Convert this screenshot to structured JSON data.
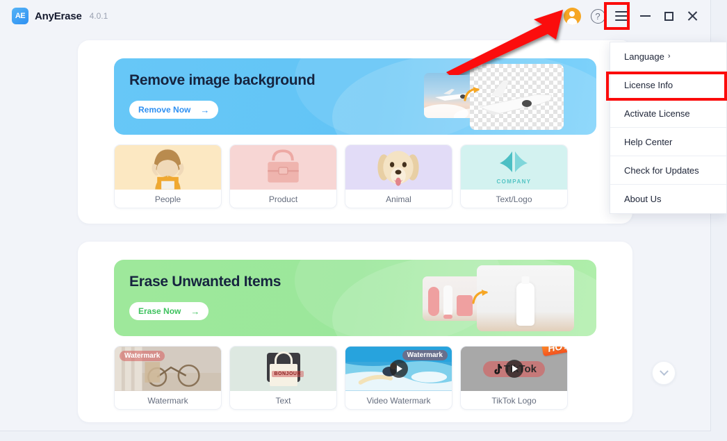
{
  "app": {
    "name": "AnyErase",
    "version": "4.0.1",
    "logo_text": "AE"
  },
  "titlebar": {
    "icons": [
      {
        "name": "account-avatar",
        "label": "Account"
      },
      {
        "name": "help-icon",
        "label": "?"
      },
      {
        "name": "menu-hamburger-icon",
        "label": "Menu"
      },
      {
        "name": "minimize-icon",
        "label": "Minimize"
      },
      {
        "name": "maximize-icon",
        "label": "Maximize"
      },
      {
        "name": "close-icon",
        "label": "Close"
      }
    ]
  },
  "dropdown_menu": {
    "items": [
      {
        "label": "Language",
        "has_submenu": true,
        "caret": "›"
      },
      {
        "label": "License Info",
        "has_submenu": false,
        "highlighted": true
      },
      {
        "label": "Activate License",
        "has_submenu": false
      },
      {
        "label": "Help Center",
        "has_submenu": false
      },
      {
        "label": "Check for Updates",
        "has_submenu": false
      },
      {
        "label": "About Us",
        "has_submenu": false
      }
    ]
  },
  "sections": [
    {
      "id": "remove-background",
      "banner": {
        "title": "Remove image background",
        "button_label": "Remove Now",
        "arrow": "→",
        "theme_color": "#62c4f6"
      },
      "cards": [
        {
          "label": "People",
          "image": "girl-photo"
        },
        {
          "label": "Product",
          "image": "pink-handbag-photo"
        },
        {
          "label": "Animal",
          "image": "golden-retriever-photo"
        },
        {
          "label": "Text/Logo",
          "image": "company-logo-graphic",
          "logo_caption": "COMPANY"
        }
      ],
      "scroll_button": "chevron-down"
    },
    {
      "id": "erase-unwanted-items",
      "banner": {
        "title": "Erase Unwanted Items",
        "button_label": "Erase Now",
        "arrow": "→",
        "theme_color": "#9be79b"
      },
      "cards": [
        {
          "label": "Watermark",
          "image": "bicycle-photo",
          "overlay_tag": "Watermark"
        },
        {
          "label": "Text",
          "image": "tote-bag-photo",
          "overlay_tag": "BONJOUR"
        },
        {
          "label": "Video Watermark",
          "image": "surfer-photo",
          "overlay_tag": "Watermark",
          "has_play": true
        },
        {
          "label": "TikTok Logo",
          "image": "tiktok-logo",
          "overlay_tag": "TikTok",
          "has_play": true,
          "badge": "HOT!"
        }
      ],
      "scroll_button": "chevron-down"
    }
  ],
  "annotations": {
    "highlight_color": "#fb0b0b",
    "arrow_target": "menu-hamburger-icon",
    "boxes": [
      "menu-hamburger-icon",
      "License Info"
    ]
  }
}
